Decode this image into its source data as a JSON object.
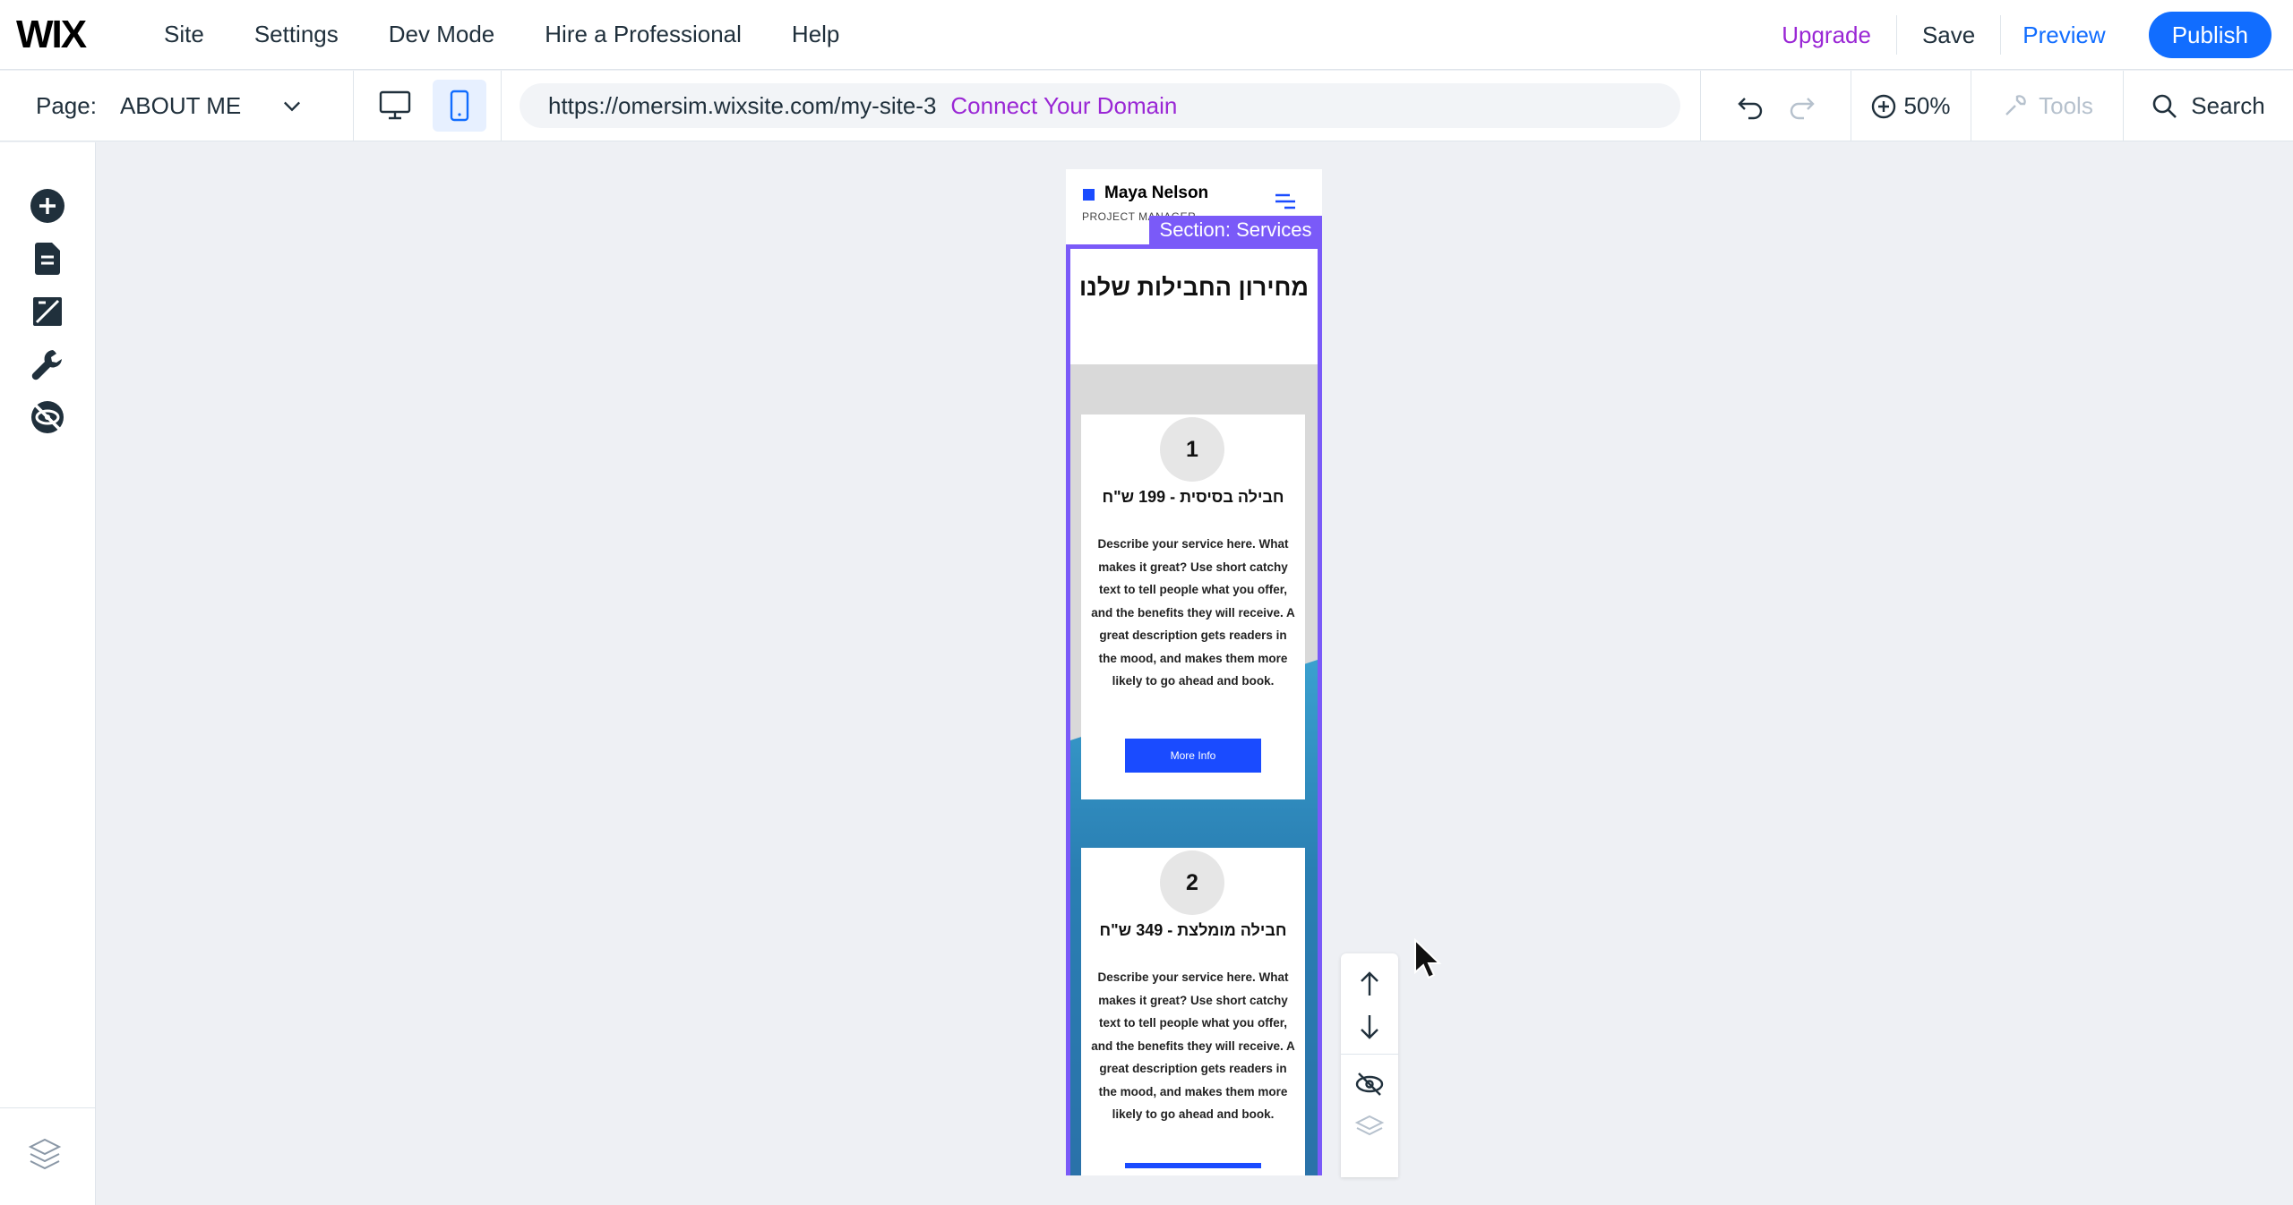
{
  "app": {
    "logo": "WIX",
    "menu": [
      "Site",
      "Settings",
      "Dev Mode",
      "Hire a Professional",
      "Help"
    ],
    "upgrade_label": "Upgrade",
    "save_label": "Save",
    "preview_label": "Preview",
    "publish_label": "Publish",
    "accent_color": "#116dff",
    "upgrade_color": "#9a27d5"
  },
  "toolbar": {
    "page_label": "Page:",
    "page_name": "ABOUT ME",
    "url": "https://omersim.wixsite.com/my-site-3",
    "connect_domain_label": "Connect Your Domain",
    "zoom": "50%",
    "tools_label": "Tools",
    "search_label": "Search"
  },
  "left_rail": {
    "icons": [
      "add-icon",
      "pages-icon",
      "design-icon",
      "wrench-icon",
      "hidden-elements-icon",
      "layers-icon"
    ]
  },
  "site": {
    "owner_name": "Maya Nelson",
    "owner_role": "PROJECT MANAGER",
    "section_tag": "Section: Services",
    "section_color": "#7a5af8",
    "section_title": "מחירון החבילות שלנו",
    "cards": [
      {
        "number": "1",
        "title": "חבילה בסיסית - 199 ש\"ח",
        "description": "Describe your service here. What makes it great? Use short catchy text to tell people what you offer, and the benefits they will receive. A great description gets readers in the mood, and makes them more likely to go ahead and book.",
        "button_label": "More Info"
      },
      {
        "number": "2",
        "title": "חבילה מומלצת - 349 ש\"ח",
        "description": "Describe your service here. What makes it great? Use short catchy text to tell people what you offer, and the benefits they will receive. A great description gets readers in the mood, and makes them more likely to go ahead and book.",
        "button_label": ""
      }
    ]
  },
  "floating_actions": [
    "move-up-icon",
    "move-down-icon",
    "hide-icon",
    "layers-icon"
  ]
}
